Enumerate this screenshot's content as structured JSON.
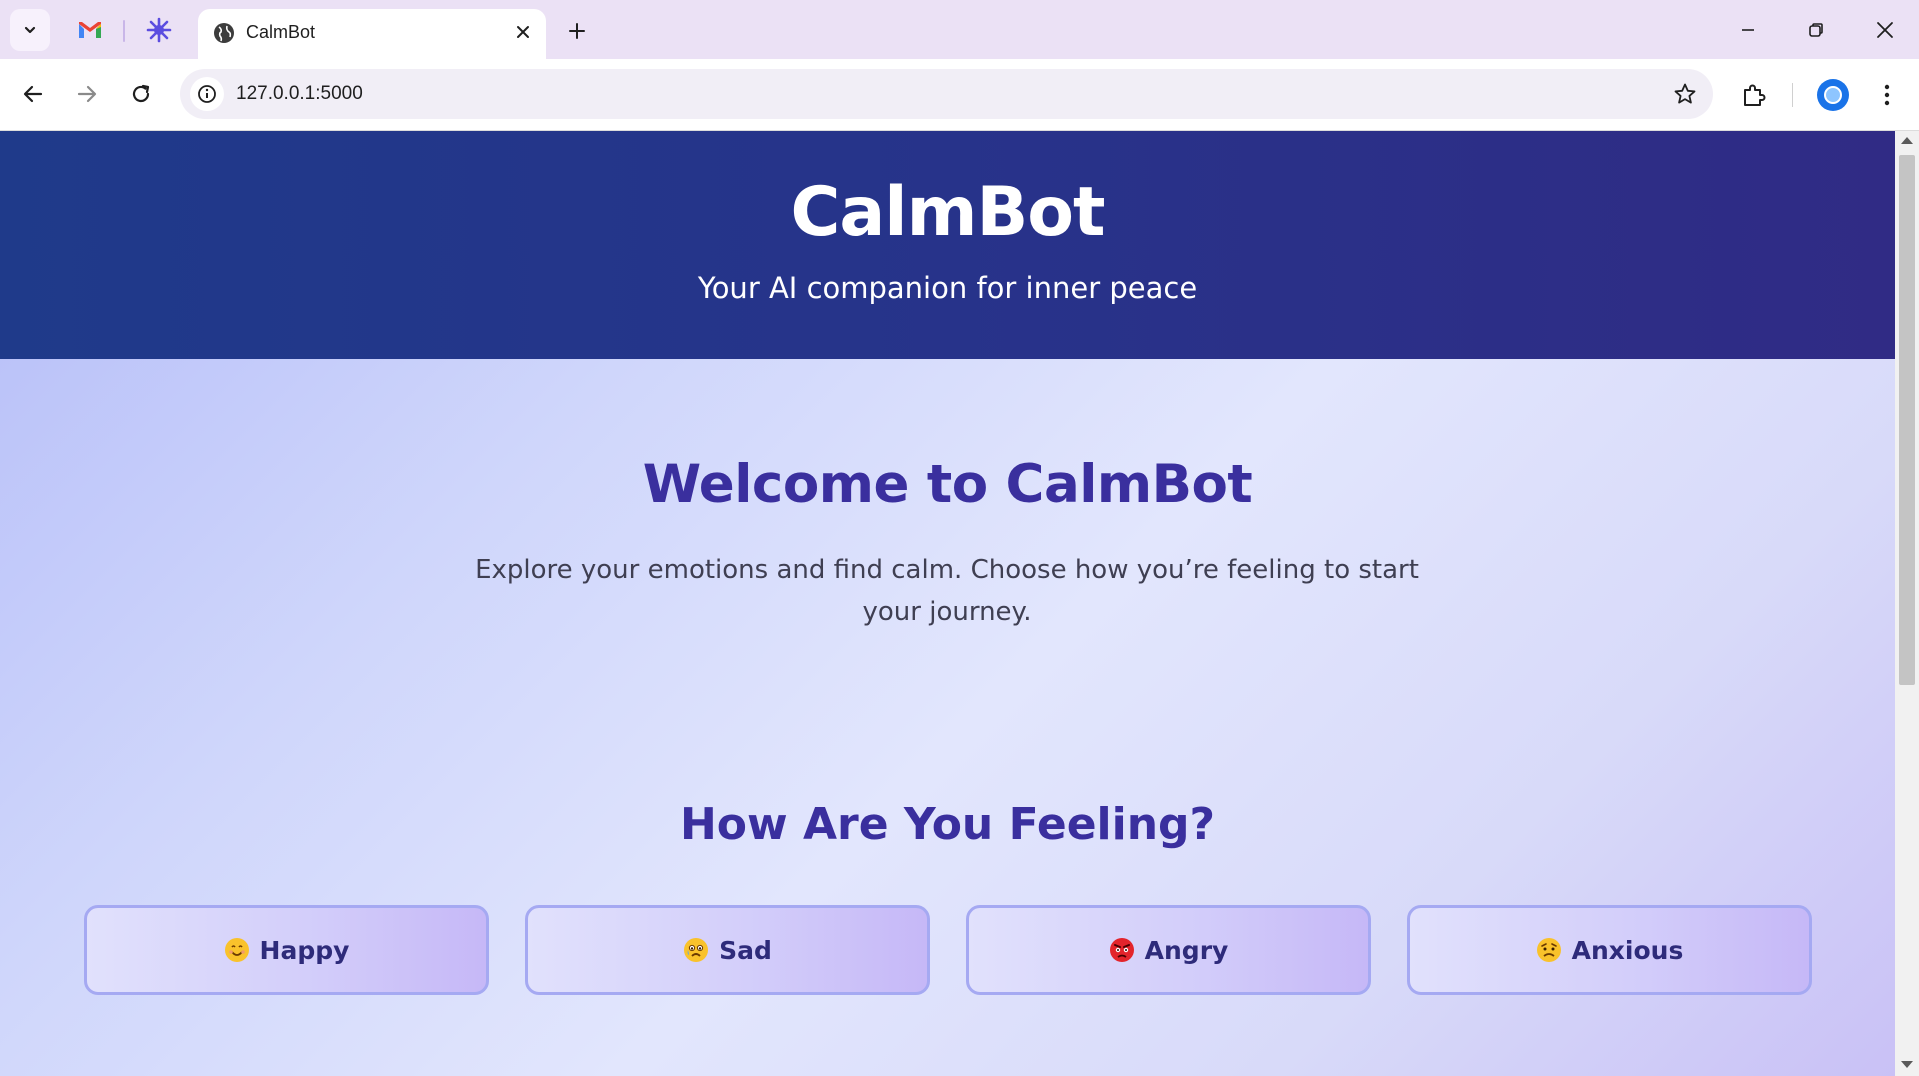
{
  "browser": {
    "tab_title": "CalmBot",
    "url": "127.0.0.1:5000",
    "pinned_tabs": [
      "gmail-icon",
      "sparkle-icon"
    ]
  },
  "page": {
    "brand_title": "CalmBot",
    "brand_subtitle": "Your AI companion for inner peace",
    "welcome_title": "Welcome to CalmBot",
    "welcome_text": "Explore your emotions and find calm. Choose how you’re feeling to start your journey.",
    "feeling_title": "How Are You Feeling?",
    "moods": [
      {
        "label": "Happy",
        "emoji": "😊"
      },
      {
        "label": "Sad",
        "emoji": "😢"
      },
      {
        "label": "Angry",
        "emoji": "😡"
      },
      {
        "label": "Anxious",
        "emoji": "😟"
      }
    ]
  },
  "colors": {
    "hero_bg": "#27338a",
    "heading": "#3a2f9e",
    "button_border": "#a5a9f2"
  }
}
